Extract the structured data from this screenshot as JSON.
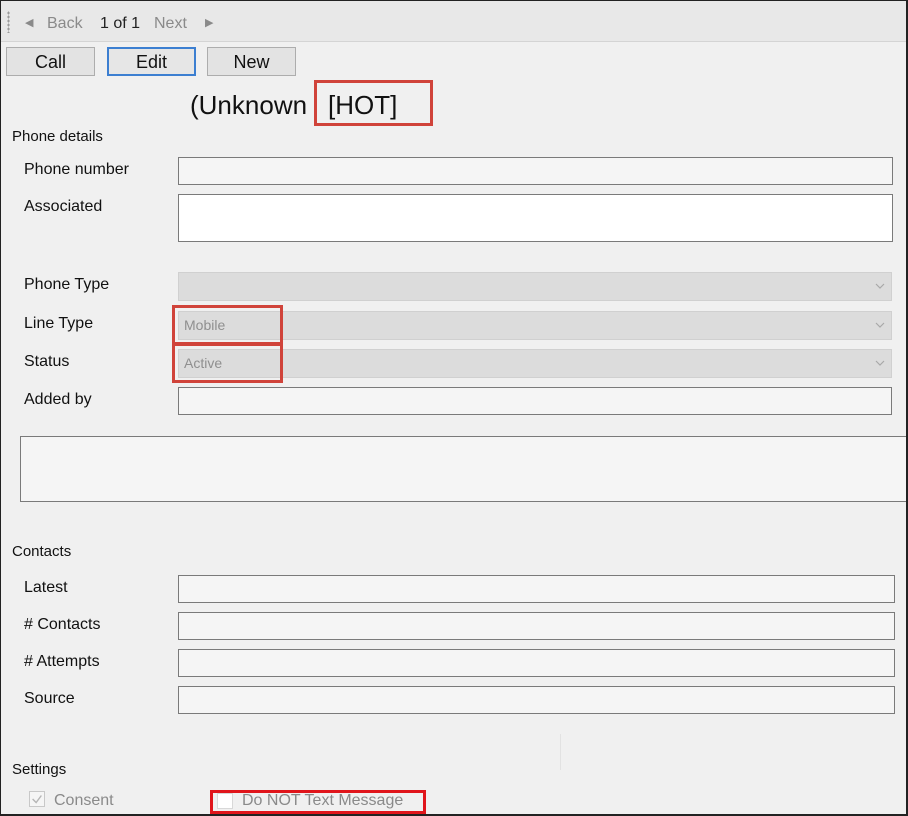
{
  "nav": {
    "back_label": "Back",
    "page_info": "1 of 1",
    "next_label": "Next"
  },
  "toolbar": {
    "call_label": "Call",
    "edit_label": "Edit",
    "new_label": "New"
  },
  "title": {
    "name": "(Unknown",
    "tag": "[HOT]"
  },
  "phone_details": {
    "heading": "Phone details",
    "phone_number_label": "Phone  number",
    "phone_number_value": "",
    "associated_label": "Associated",
    "associated_value": "",
    "phone_type_label": "Phone Type",
    "phone_type_value": "",
    "line_type_label": "Line Type",
    "line_type_value": "Mobile",
    "status_label": "Status",
    "status_value": "Active",
    "added_by_label": "Added by",
    "added_by_value": "",
    "notes_value": ""
  },
  "contacts": {
    "heading": "Contacts",
    "latest_label": "Latest",
    "latest_value": "",
    "contacts_count_label": "# Contacts",
    "contacts_count_value": "",
    "attempts_label": "# Attempts",
    "attempts_value": "",
    "source_label": "Source",
    "source_value": ""
  },
  "settings": {
    "heading": "Settings",
    "consent_label": "Consent",
    "consent_checked": true,
    "do_not_text_label": "Do NOT Text Message",
    "do_not_text_checked": false
  },
  "colors": {
    "highlight": "#d0433a",
    "highlight_strong": "#e0151b",
    "focus_border": "#3c7fd1"
  },
  "icons": [
    "left-triangle-icon",
    "right-triangle-icon",
    "chevron-down-icon",
    "checkmark-icon",
    "grip-icon"
  ]
}
